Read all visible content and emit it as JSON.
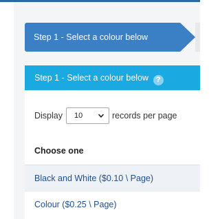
{
  "wizard": {
    "active_step_label": "Step 1 - Select a colour below"
  },
  "panel": {
    "title": "Step 1 - Select a colour below",
    "help_icon_glyph": "?"
  },
  "records": {
    "prefix": "Display",
    "selected_value": "10",
    "suffix": "records per page"
  },
  "table": {
    "column_header": "Choose one",
    "rows": [
      {
        "label": "Black and White ($0.10 \\ Page)"
      },
      {
        "label": "Colour ($0.25 \\ Page)"
      }
    ]
  },
  "colors": {
    "step_active": "#3b7fc4",
    "panel_header": "#1ba9e1",
    "link": "#1f4f8f",
    "content_bg": "#f4f5f6"
  }
}
